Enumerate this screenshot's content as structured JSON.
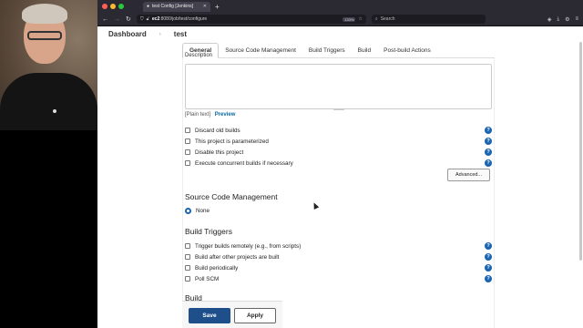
{
  "browser": {
    "tab_title": "test Config [Jenkins]",
    "url_host": "ec2",
    "url_rest": ":8080/job/test/configure",
    "zoom": "133%",
    "search_placeholder": "Search"
  },
  "breadcrumb": {
    "dashboard": "Dashboard",
    "separator": "›",
    "job": "test"
  },
  "tabs": [
    "General",
    "Source Code Management",
    "Build Triggers",
    "Build",
    "Post-build Actions"
  ],
  "general": {
    "description_label": "Description",
    "plain_text": "[Plain text]",
    "preview": "Preview",
    "options": [
      "Discard old builds",
      "This project is parameterized",
      "Disable this project",
      "Execute concurrent builds if necessary"
    ],
    "advanced_label": "Advanced..."
  },
  "scm": {
    "title": "Source Code Management",
    "selected": "None"
  },
  "build_triggers": {
    "title": "Build Triggers",
    "options": [
      "Trigger builds remotely (e.g., from scripts)",
      "Build after other projects are built",
      "Build periodically",
      "Poll SCM"
    ]
  },
  "build": {
    "title": "Build"
  },
  "actions": {
    "save": "Save",
    "apply": "Apply"
  },
  "help_glyph": "?",
  "colors": {
    "accent": "#1e4f8a",
    "help": "#1a64b0",
    "link": "#0b6aa2"
  }
}
